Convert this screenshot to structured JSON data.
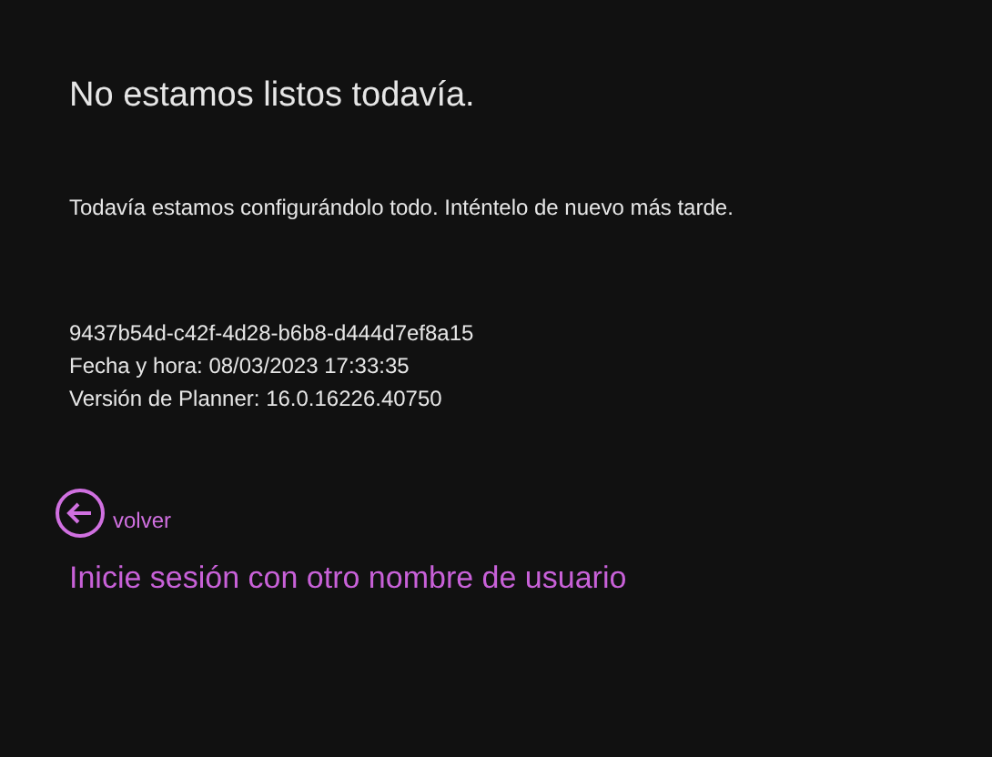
{
  "title": "No estamos listos todavía.",
  "message": "Todavía estamos configurándolo todo. Inténtelo de nuevo más tarde.",
  "details": [
    "9437b54d-c42f-4d28-b6b8-d444d7ef8a15",
    "Fecha y hora: 08/03/2023 17:33:35",
    "Versión de Planner: 16.0.16226.40750"
  ],
  "back_link": "volver",
  "signin_link": "Inicie sesión con otro nombre de usuario"
}
